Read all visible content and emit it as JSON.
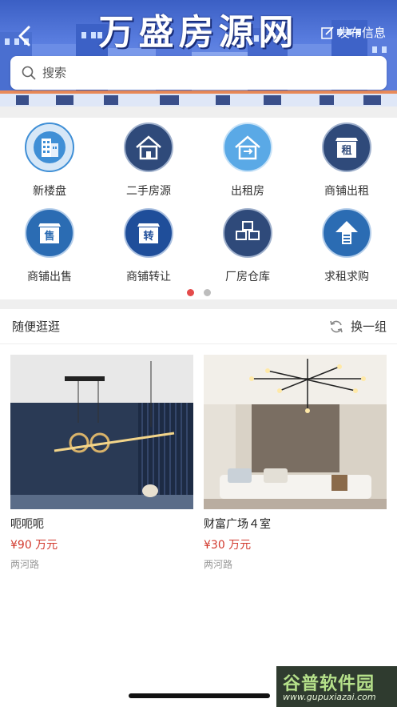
{
  "header": {
    "banner_title": "万盛房源网",
    "publish_label": "发布信息",
    "back_icon": "chevron-left-icon",
    "publish_icon": "edit-icon"
  },
  "search": {
    "placeholder": "搜索",
    "icon": "search-icon"
  },
  "categories": [
    {
      "label": "新楼盘",
      "icon": "building-icon",
      "color": "#3f8fd6"
    },
    {
      "label": "二手房源",
      "icon": "house-icon",
      "color": "#2f4a7a"
    },
    {
      "label": "出租房",
      "icon": "rent-house-icon",
      "color": "#5aa9e6"
    },
    {
      "label": "商铺出租",
      "icon": "shop-rent-icon",
      "color": "#2f4a7a"
    },
    {
      "label": "商铺出售",
      "icon": "shop-sale-icon",
      "color": "#2b6cb3"
    },
    {
      "label": "商铺转让",
      "icon": "shop-transfer-icon",
      "color": "#1f4e9a"
    },
    {
      "label": "厂房仓库",
      "icon": "warehouse-icon",
      "color": "#2f4a7a"
    },
    {
      "label": "求租求购",
      "icon": "wanted-icon",
      "color": "#2b6cb3"
    }
  ],
  "icon_glyphs": {
    "rent": "租",
    "sale": "售",
    "transfer": "转"
  },
  "pager": {
    "pages": 2,
    "active": 1,
    "active_color": "#e44b4b"
  },
  "section": {
    "title": "随便逛逛",
    "refresh_label": "换一组",
    "refresh_icon": "refresh-icon"
  },
  "listings": [
    {
      "name": "呃呃呃",
      "price": "¥90 万元",
      "location": "两河路"
    },
    {
      "name": "财富广场４室",
      "price": "¥30 万元",
      "location": "两河路"
    }
  ],
  "watermark": {
    "main": "谷普软件园",
    "sub": "www.gupuxiazai.com"
  }
}
